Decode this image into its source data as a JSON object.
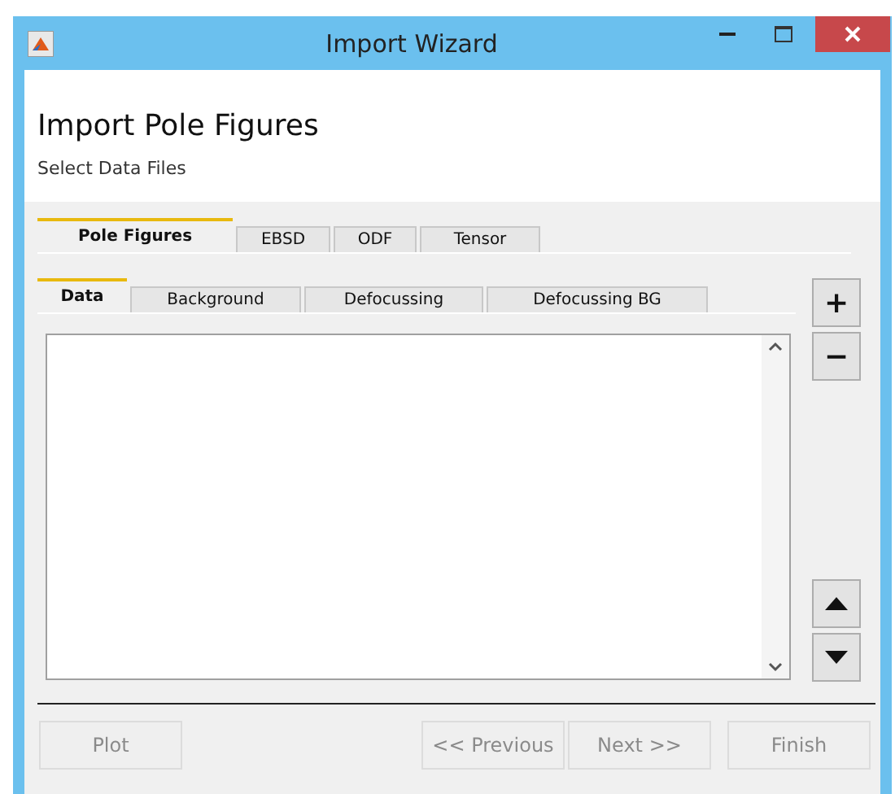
{
  "window": {
    "title": "Import Wizard"
  },
  "header": {
    "title": "Import Pole Figures",
    "subtitle": "Select Data Files"
  },
  "tabs": [
    {
      "label": "Pole Figures",
      "selected": true
    },
    {
      "label": "EBSD",
      "selected": false
    },
    {
      "label": "ODF",
      "selected": false
    },
    {
      "label": "Tensor",
      "selected": false
    }
  ],
  "subtabs": [
    {
      "label": "Data",
      "selected": true
    },
    {
      "label": "Background",
      "selected": false
    },
    {
      "label": "Defocussing",
      "selected": false
    },
    {
      "label": "Defocussing BG",
      "selected": false
    }
  ],
  "side_buttons": [
    {
      "label": "+"
    },
    {
      "label": "−"
    }
  ],
  "buttons": [
    {
      "label": "Plot",
      "disabled": true
    },
    {
      "label": "<< Previous",
      "disabled": true
    },
    {
      "label": "Next >>",
      "disabled": true
    },
    {
      "label": "Finish",
      "disabled": true
    }
  ]
}
